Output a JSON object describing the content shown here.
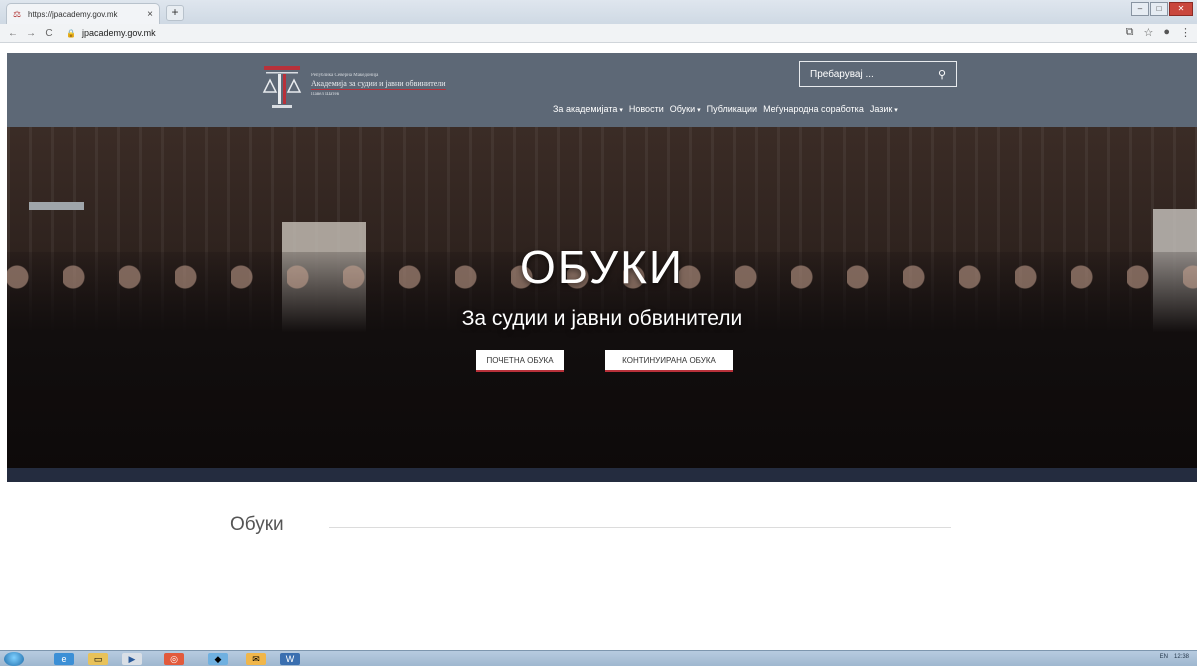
{
  "browser": {
    "tab_title": "https://jpacademy.gov.mk",
    "tab_close": "×",
    "new_tab": "+",
    "url": "jpacademy.gov.mk",
    "icons": [
      "back-icon",
      "forward-icon",
      "reload-icon",
      "lock-icon",
      "translate-icon",
      "star-icon",
      "profile-icon",
      "menu-icon"
    ]
  },
  "header": {
    "logo_line1": "Република Северна Македонија",
    "logo_line2": "Академија за судии и јавни обвинители",
    "logo_line3": "Павел Шатев",
    "search_placeholder": "Пребарувај ...",
    "search_icon": "search-icon",
    "nav": [
      {
        "label": "За академијата",
        "dropdown": true
      },
      {
        "label": "Новости",
        "dropdown": false
      },
      {
        "label": "Обуки",
        "dropdown": true
      },
      {
        "label": "Публикации",
        "dropdown": false
      },
      {
        "label": "Меѓународна соработка",
        "dropdown": false
      },
      {
        "label": "Јазик",
        "dropdown": true
      }
    ]
  },
  "hero": {
    "title": "ОБУКИ",
    "subtitle": "За судии и јавни обвинители",
    "button_initial": "ПОЧЕТНА ОБУКА",
    "button_continuing": "КОНТИНУИРАНА ОБУКА"
  },
  "section": {
    "title": "Обуки"
  },
  "taskbar": {
    "tray_lang": "EN",
    "time": "12:38"
  },
  "colors": {
    "header_bg": "#5d6876",
    "accent": "#b8313a"
  }
}
